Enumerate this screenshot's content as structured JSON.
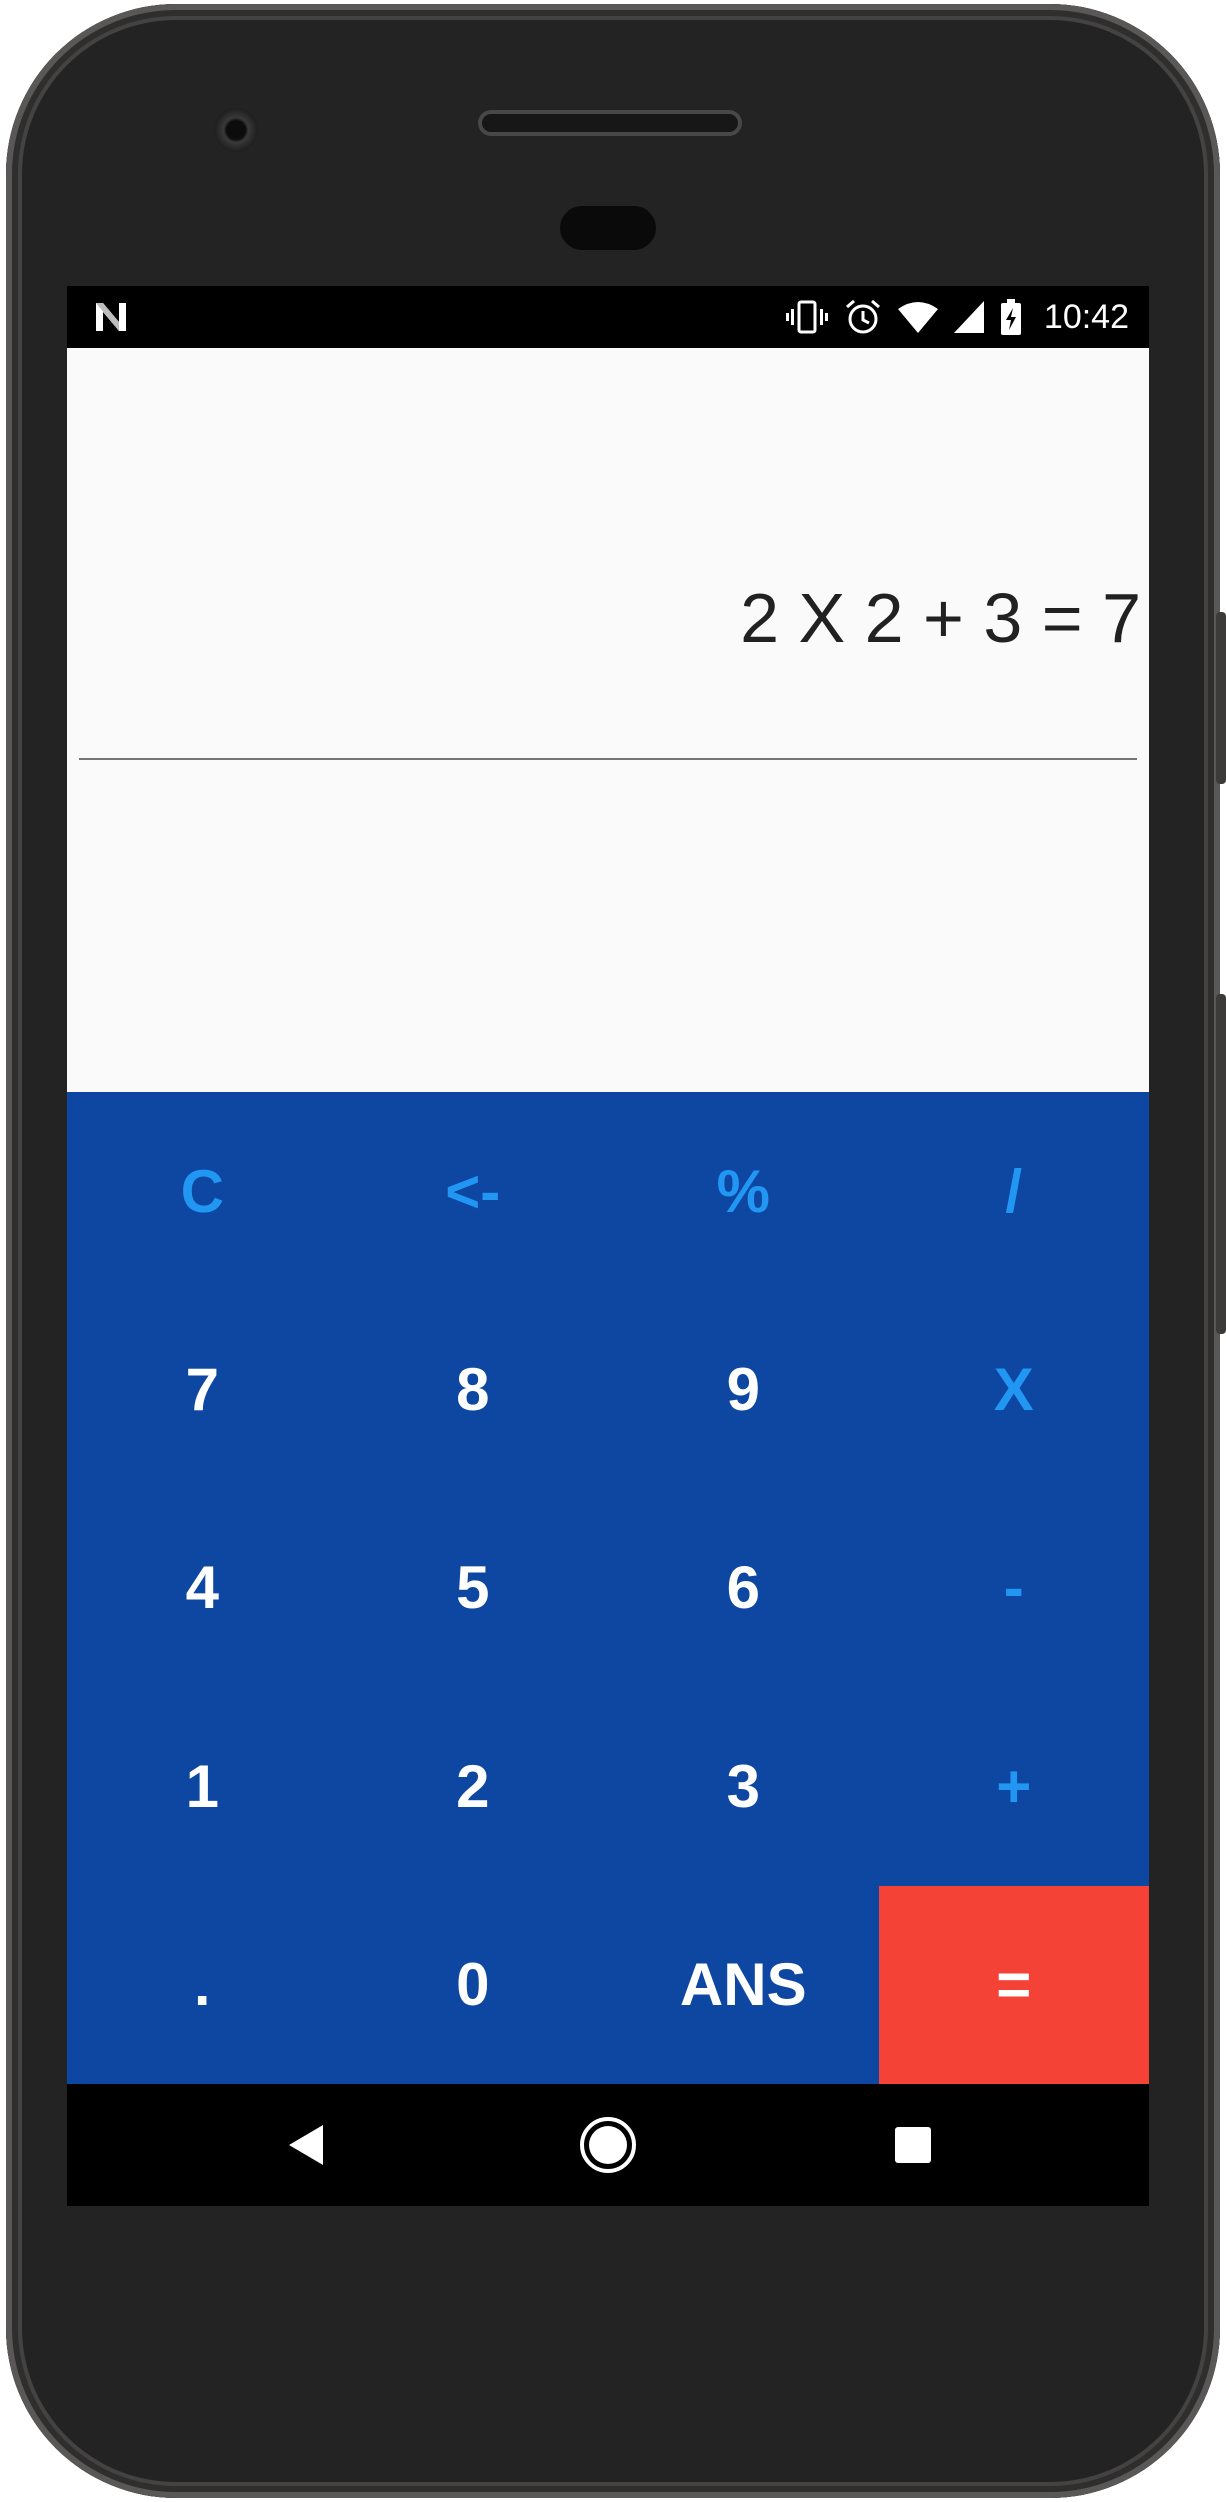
{
  "status_bar": {
    "time": "10:42",
    "left_icon": "n-logo-icon",
    "right_icons": [
      "vibrate-icon",
      "alarm-icon",
      "wifi-icon",
      "signal-icon",
      "battery-icon"
    ]
  },
  "display": {
    "expression": "2 X 2 + 3 = 7",
    "result": ""
  },
  "keypad": {
    "rows": [
      [
        {
          "label": "C",
          "type": "op",
          "name": "clear-button"
        },
        {
          "label": "<-",
          "type": "op",
          "name": "backspace-button"
        },
        {
          "label": "%",
          "type": "op",
          "name": "percent-button"
        },
        {
          "label": "/",
          "type": "op",
          "name": "divide-button"
        }
      ],
      [
        {
          "label": "7",
          "type": "digit",
          "name": "digit-7-button"
        },
        {
          "label": "8",
          "type": "digit",
          "name": "digit-8-button"
        },
        {
          "label": "9",
          "type": "digit",
          "name": "digit-9-button"
        },
        {
          "label": "X",
          "type": "op",
          "name": "multiply-button"
        }
      ],
      [
        {
          "label": "4",
          "type": "digit",
          "name": "digit-4-button"
        },
        {
          "label": "5",
          "type": "digit",
          "name": "digit-5-button"
        },
        {
          "label": "6",
          "type": "digit",
          "name": "digit-6-button"
        },
        {
          "label": "-",
          "type": "op",
          "name": "subtract-button"
        }
      ],
      [
        {
          "label": "1",
          "type": "digit",
          "name": "digit-1-button"
        },
        {
          "label": "2",
          "type": "digit",
          "name": "digit-2-button"
        },
        {
          "label": "3",
          "type": "digit",
          "name": "digit-3-button"
        },
        {
          "label": "+",
          "type": "op",
          "name": "add-button"
        }
      ],
      [
        {
          "label": ".",
          "type": "digit",
          "name": "decimal-button"
        },
        {
          "label": "0",
          "type": "digit",
          "name": "digit-0-button"
        },
        {
          "label": "ANS",
          "type": "digit",
          "name": "ans-button"
        },
        {
          "label": "=",
          "type": "eq",
          "name": "equals-button"
        }
      ]
    ]
  },
  "nav_bar": {
    "icons": [
      "back-icon",
      "home-icon",
      "recents-icon"
    ]
  },
  "colors": {
    "keypad_bg": "#0e47a1",
    "operator_text": "#2196f3",
    "digit_text": "#ffffff",
    "equals_bg": "#f44237",
    "display_bg": "#fafafa"
  }
}
